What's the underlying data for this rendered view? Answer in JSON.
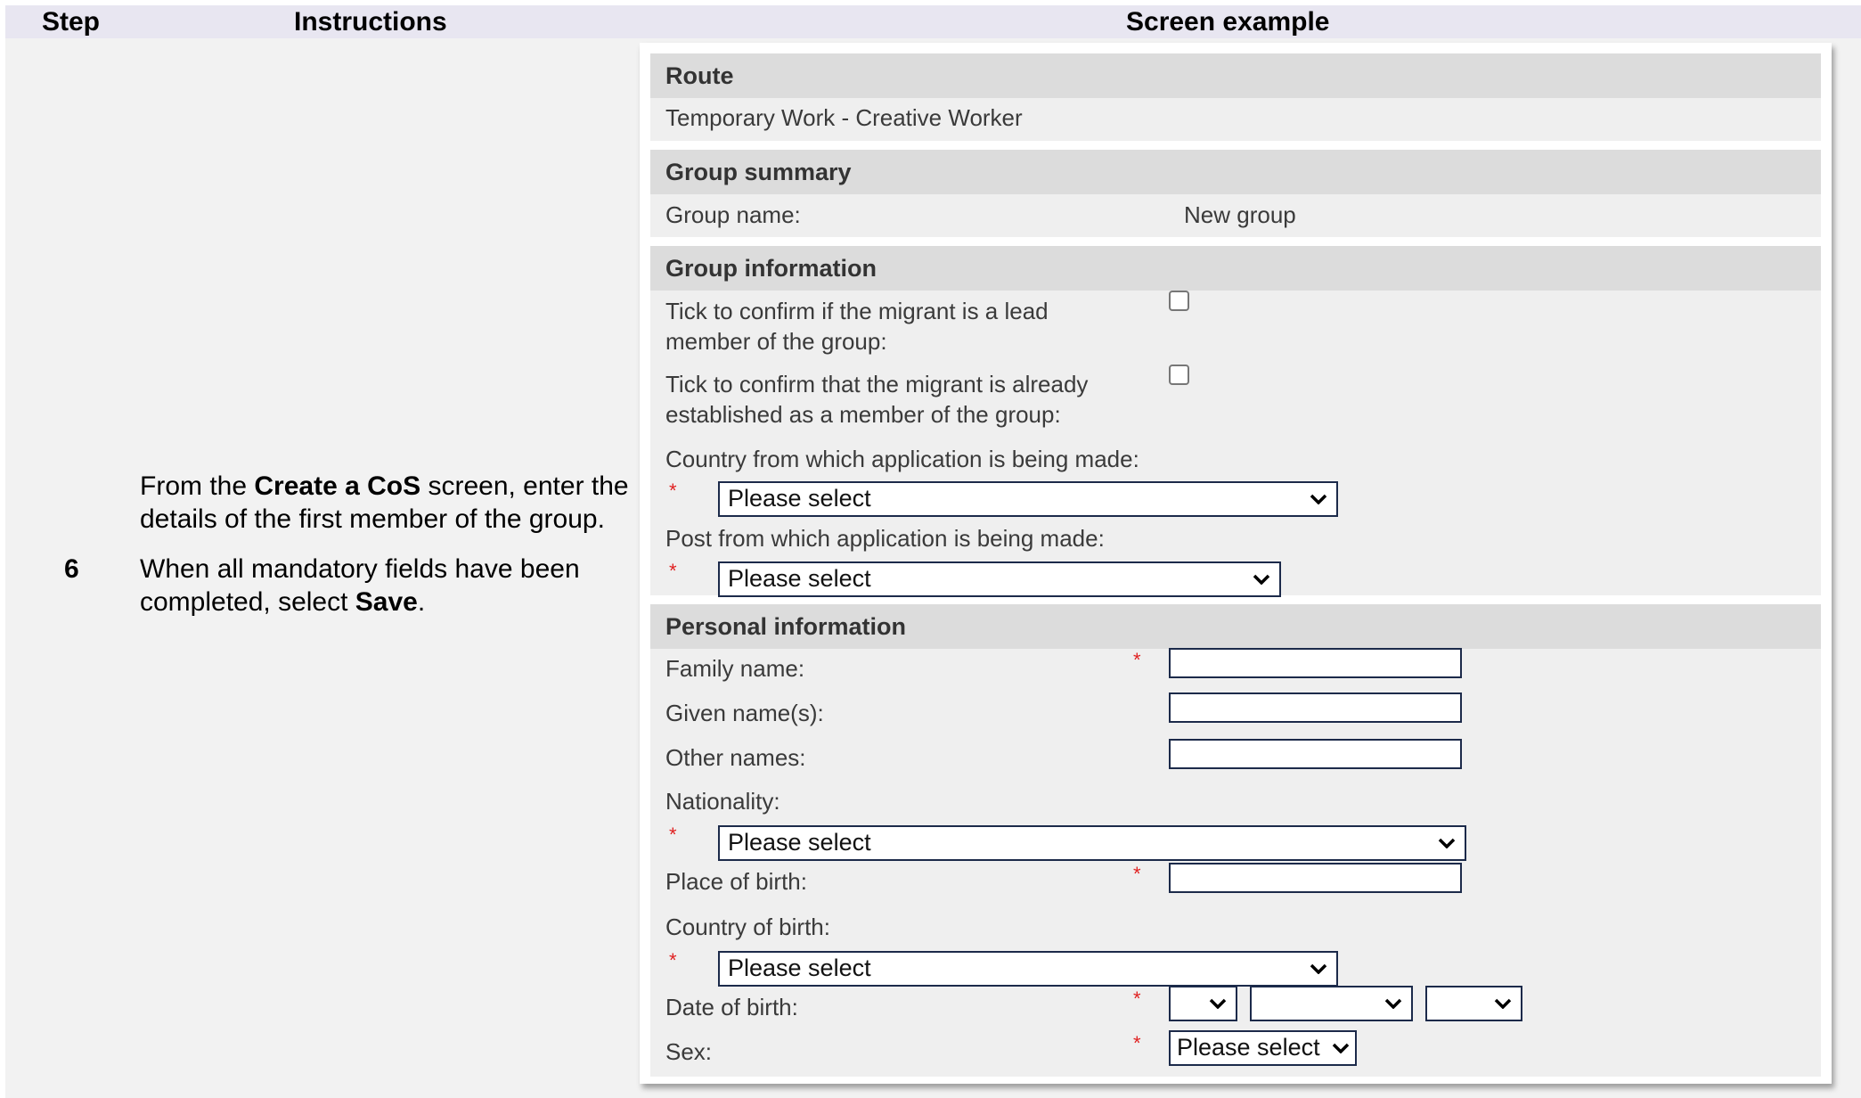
{
  "header": {
    "step": "Step",
    "instructions": "Instructions",
    "screen_example": "Screen example"
  },
  "row": {
    "step_number": "6",
    "instr": {
      "p1_a": "From the ",
      "p1_b": "Create a CoS",
      "p1_c": " screen, enter the details of the first member of the group.",
      "p2_a": "When all mandatory fields have been completed, select ",
      "p2_b": "Save",
      "p2_c": "."
    }
  },
  "screen": {
    "route": {
      "heading": "Route",
      "value": "Temporary Work - Creative Worker"
    },
    "group_summary": {
      "heading": "Group summary",
      "name_label": "Group name:",
      "name_value": "New group"
    },
    "group_info": {
      "heading": "Group information",
      "lead_label": "Tick to confirm if the migrant is a lead member of the group:",
      "established_label": "Tick to confirm that the migrant is already established as a member of the group:",
      "country_label": "Country from which application is being made:",
      "country_value": "Please select",
      "post_label": "Post from which application is being made:",
      "post_value": "Please select"
    },
    "personal": {
      "heading": "Personal information",
      "family_label": "Family name:",
      "given_label": "Given name(s):",
      "other_label": "Other names:",
      "nationality_label": "Nationality:",
      "nationality_value": "Please select",
      "pob_label": "Place of birth:",
      "cob_label": "Country of birth:",
      "cob_value": "Please select",
      "dob_label": "Date of birth:",
      "sex_label": "Sex:",
      "sex_value": "Please select"
    },
    "required_marker": "*",
    "chevron_icon": "chevron-down-icon"
  }
}
